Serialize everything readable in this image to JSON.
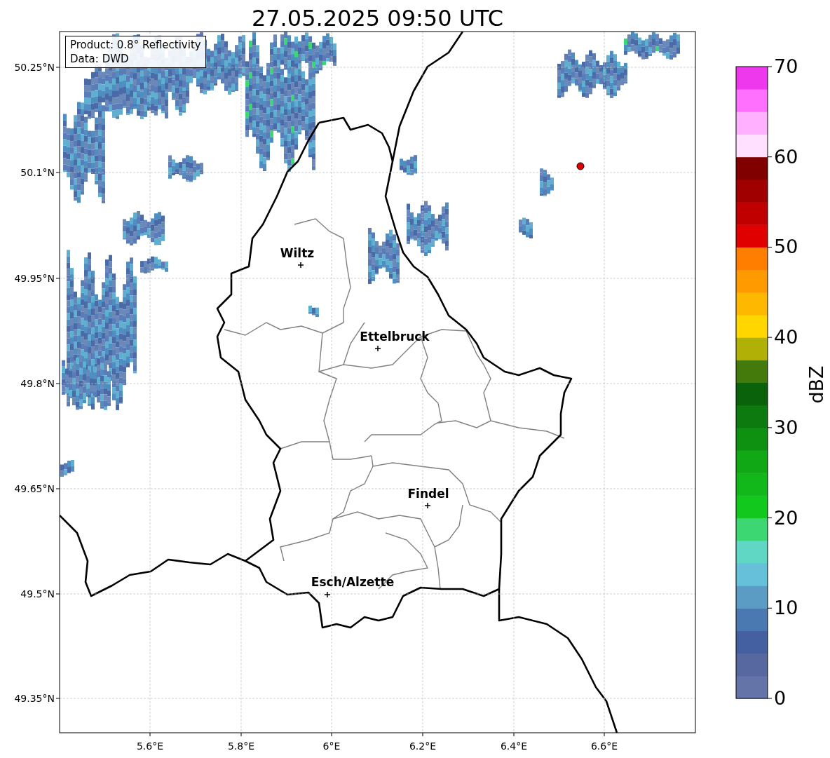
{
  "title": "27.05.2025 09:50 UTC",
  "info_box": {
    "lines": [
      "Product: 0.8° Reflectivity",
      "Data: DWD"
    ]
  },
  "y_ticks": [
    "50.25°N",
    "50.1°N",
    "49.95°N",
    "49.8°N",
    "49.65°N",
    "49.5°N",
    "49.35°N"
  ],
  "x_ticks": [
    "5.6°E",
    "5.8°E",
    "6°E",
    "6.2°E",
    "6.4°E",
    "6.6°E"
  ],
  "cities": [
    {
      "name": "Wiltz"
    },
    {
      "name": "Ettelbruck"
    },
    {
      "name": "Findel"
    },
    {
      "name": "Esch/Alzette"
    }
  ],
  "colorbar": {
    "label": "dBZ",
    "ticks": [
      "70",
      "60",
      "50",
      "40",
      "30",
      "20",
      "10",
      "0"
    ],
    "segments": [
      {
        "color": "#6473a8"
      },
      {
        "color": "#56689f"
      },
      {
        "color": "#4560a0"
      },
      {
        "color": "#4a78b0"
      },
      {
        "color": "#5a9cc4"
      },
      {
        "color": "#66c0da"
      },
      {
        "color": "#60d6c4"
      },
      {
        "color": "#3cd672"
      },
      {
        "color": "#12c81c"
      },
      {
        "color": "#12b81a"
      },
      {
        "color": "#10a814"
      },
      {
        "color": "#0e9010"
      },
      {
        "color": "#0c7a0e"
      },
      {
        "color": "#0a620a"
      },
      {
        "color": "#447a0c"
      },
      {
        "color": "#b0b006"
      },
      {
        "color": "#ffd600"
      },
      {
        "color": "#ffb800"
      },
      {
        "color": "#ff9a00"
      },
      {
        "color": "#ff7e00"
      },
      {
        "color": "#e00000"
      },
      {
        "color": "#c00000"
      },
      {
        "color": "#a00000"
      },
      {
        "color": "#800000"
      },
      {
        "color": "#ffe0ff"
      },
      {
        "color": "#ffb0ff"
      },
      {
        "color": "#ff70ff"
      },
      {
        "color": "#ee38ee"
      }
    ]
  }
}
